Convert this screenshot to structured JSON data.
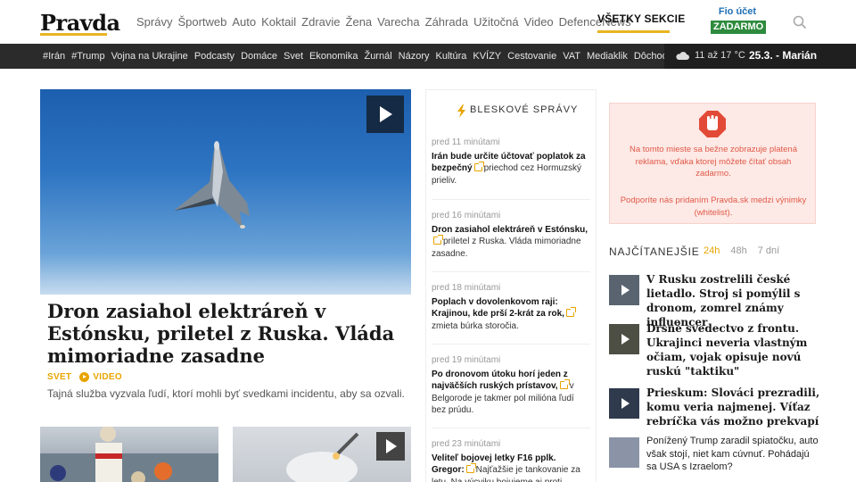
{
  "header": {
    "logo": "Pravda",
    "nav": [
      "Správy",
      "Športweb",
      "Auto",
      "Koktail",
      "Zdravie",
      "Žena",
      "Varecha",
      "Záhrada",
      "Užitočná",
      "Video",
      "DefenceNews"
    ],
    "all_sections": "VŠETKY SEKCIE",
    "fio_top": "Fio účet",
    "fio_bottom": "ZADARMO",
    "search_icon": "search-icon"
  },
  "tagbar": {
    "tags": [
      "#Irán",
      "#Trump",
      "Vojna na Ukrajine",
      "Podcasty",
      "Domáce",
      "Svet",
      "Ekonomika",
      "Žurnál",
      "Názory",
      "Kultúra",
      "KVÍZY",
      "Cestovanie",
      "VAT",
      "Mediaklik",
      "Dôchodky"
    ],
    "weather_icon": "cloud-icon",
    "temperature": "11 až 17 °C",
    "date_name": "25.3. - Marián"
  },
  "hero": {
    "headline": "Dron zasiahol elektráreň v Estónsku, priletel z Ruska. Vláda mimoriadne zasadne",
    "section": "SVET",
    "video_label": "VIDEO",
    "perex": "Tajná služba vyzvala ľudí, ktorí mohli byť svedkami incidentu, aby sa ozvali."
  },
  "breaking": {
    "title": "BLESKOVÉ SPRÁVY",
    "items": [
      {
        "time": "pred 11 minútami",
        "bold": "Irán bude určite účtovať poplatok za bezpečný",
        "rest": "priechod cez Hormuzský prieliv."
      },
      {
        "time": "pred 16 minútami",
        "bold": "Dron zasiahol elektráreň v Estónsku,",
        "rest": "priletel z Ruska. Vláda mimoriadne zasadne."
      },
      {
        "time": "pred 18 minútami",
        "bold": "Poplach v dovolenkovom raji: Krajinou, kde prší 2-krát za rok,",
        "rest": "zmieta búrka storočia."
      },
      {
        "time": "pred 19 minútami",
        "bold": "Po dronovom útoku horí jeden z najväčších ruských prístavov,",
        "rest": "v Belgorode je takmer pol milióna ľudí bez prúdu."
      },
      {
        "time": "pred 23 minútami",
        "bold": "Veliteľ bojovej letky F16 pplk. Gregor:",
        "rest": "Najťažšie je tankovanie za letu. Na výcviku bojujeme aj proti americkým"
      }
    ]
  },
  "ad": {
    "text1": "Na tomto mieste sa bežne zobrazuje platená reklama, vďaka ktorej môžete čítať obsah zadarmo.",
    "text2": "Podporíte nás pridaním Pravda.sk medzi výnimky (whitelist)."
  },
  "most_read": {
    "title": "NAJČÍTANEJŠIE",
    "tabs": [
      "24h",
      "48h",
      "7 dní"
    ],
    "active_tab": "24h",
    "items": [
      {
        "title": "V Rusku zostrelili české lietadlo. Stroj si pomýlil s dronom, zomrel známy influencer"
      },
      {
        "title": "Drsné svedectvo z frontu. Ukrajinci neveria vlastným očiam, vojak opisuje novú ruskú \"taktiku\""
      },
      {
        "title": "Prieskum: Slováci prezradili, komu veria najmenej. Víťaz rebríčka vás možno prekvapí"
      },
      {
        "title": "Ponížený Trump zaradil spiatočku, auto však stojí, niet kam cúvnuť. Pohádajú sa USA s Izraelom?"
      }
    ]
  },
  "colors": {
    "accent": "#e8b422",
    "dark_bar": "#2b2b2b",
    "ad_bg": "#fde9e6",
    "ad_text": "#e05a48"
  }
}
